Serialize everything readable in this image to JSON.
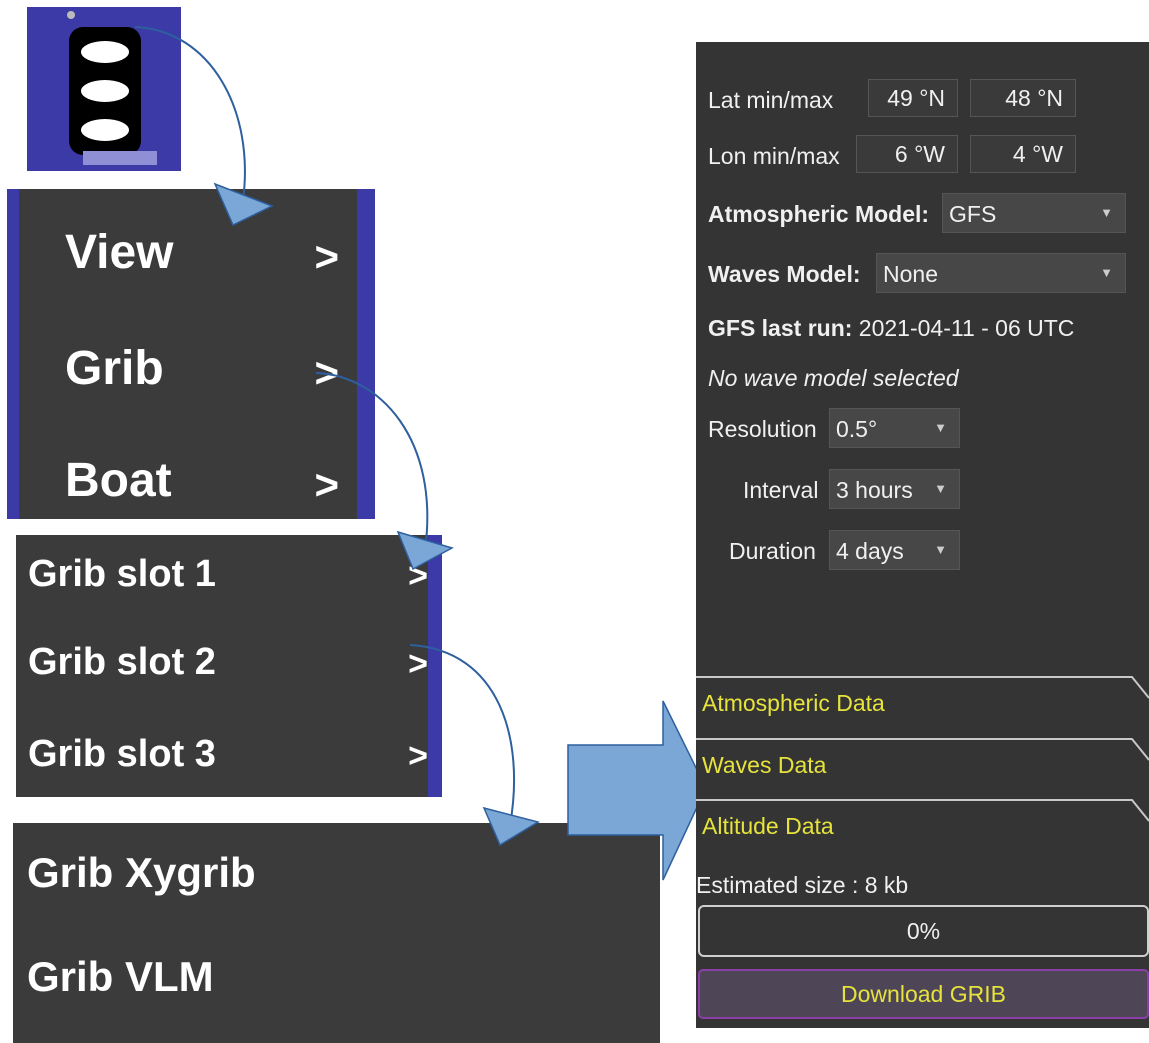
{
  "main_menu": {
    "items": [
      {
        "label": "View",
        "arrow": ">"
      },
      {
        "label": "Grib",
        "arrow": ">"
      },
      {
        "label": "Boat",
        "arrow": ">"
      }
    ]
  },
  "grib_menu": {
    "items": [
      {
        "label": "Grib slot 1",
        "arrow": ">"
      },
      {
        "label": "Grib slot 2",
        "arrow": ">"
      },
      {
        "label": "Grib slot 3",
        "arrow": ">"
      }
    ]
  },
  "slot_menu": {
    "items": [
      {
        "label": "Grib Xygrib"
      },
      {
        "label": "Grib VLM"
      }
    ]
  },
  "panel": {
    "lat": {
      "label": "Lat min/max",
      "min": "49 °N",
      "max": "48 °N"
    },
    "lon": {
      "label": "Lon min/max",
      "min": "6 °W",
      "max": "4 °W"
    },
    "atmospheric_model": {
      "label": "Atmospheric Model:",
      "value": "GFS"
    },
    "waves_model": {
      "label": "Waves Model:",
      "value": "None"
    },
    "last_run": {
      "label": "GFS last run:",
      "value": "2021-04-11 - 06 UTC"
    },
    "wave_note": "No wave model selected",
    "resolution": {
      "label": "Resolution",
      "value": "0.5°"
    },
    "interval": {
      "label": "Interval",
      "value": "3 hours"
    },
    "duration": {
      "label": "Duration",
      "value": "4 days"
    },
    "sections": [
      "Atmospheric Data",
      "Waves Data",
      "Altitude Data"
    ],
    "estimated_size": "Estimated size : 8 kb",
    "progress": "0%",
    "download_label": "Download GRIB"
  },
  "colors": {
    "menu_bg": "#3b3b3b",
    "frame_blue": "#3b3aa6",
    "panel_bg": "#343434",
    "section_text": "#e6e33c",
    "connector": "#2e5f9e",
    "arrow_fill": "#7ba7d6"
  },
  "icons": [
    "app-logo-icon",
    "chevron-right-icon",
    "dropdown-caret-icon",
    "flow-arrow-icon"
  ]
}
